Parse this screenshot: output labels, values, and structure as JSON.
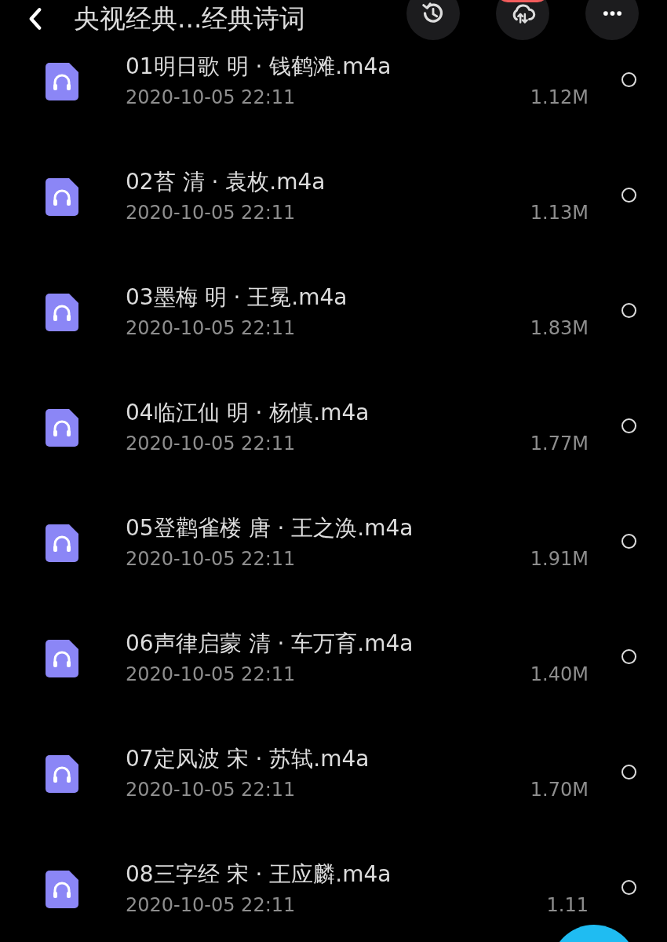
{
  "header": {
    "title": "央视经典...经典诗词",
    "badge": true
  },
  "files": [
    {
      "name": "01明日歌 明 · 钱鹤滩.m4a",
      "date": "2020-10-05 22:11",
      "size": "1.12M",
      "selected": false
    },
    {
      "name": "02苔 清 · 袁枚.m4a",
      "date": "2020-10-05 22:11",
      "size": "1.13M",
      "selected": false
    },
    {
      "name": "03墨梅 明 · 王冕.m4a",
      "date": "2020-10-05 22:11",
      "size": "1.83M",
      "selected": false
    },
    {
      "name": "04临江仙 明 · 杨慎.m4a",
      "date": "2020-10-05 22:11",
      "size": "1.77M",
      "selected": false
    },
    {
      "name": "05登鹳雀楼 唐 · 王之涣.m4a",
      "date": "2020-10-05 22:11",
      "size": "1.91M",
      "selected": false
    },
    {
      "name": "06声律启蒙 清 · 车万育.m4a",
      "date": "2020-10-05 22:11",
      "size": "1.40M",
      "selected": false
    },
    {
      "name": "07定风波 宋 · 苏轼.m4a",
      "date": "2020-10-05 22:11",
      "size": "1.70M",
      "selected": false
    },
    {
      "name": "08三字经 宋 · 王应麟.m4a",
      "date": "2020-10-05 22:11",
      "size": "1.11",
      "selected": false
    }
  ]
}
